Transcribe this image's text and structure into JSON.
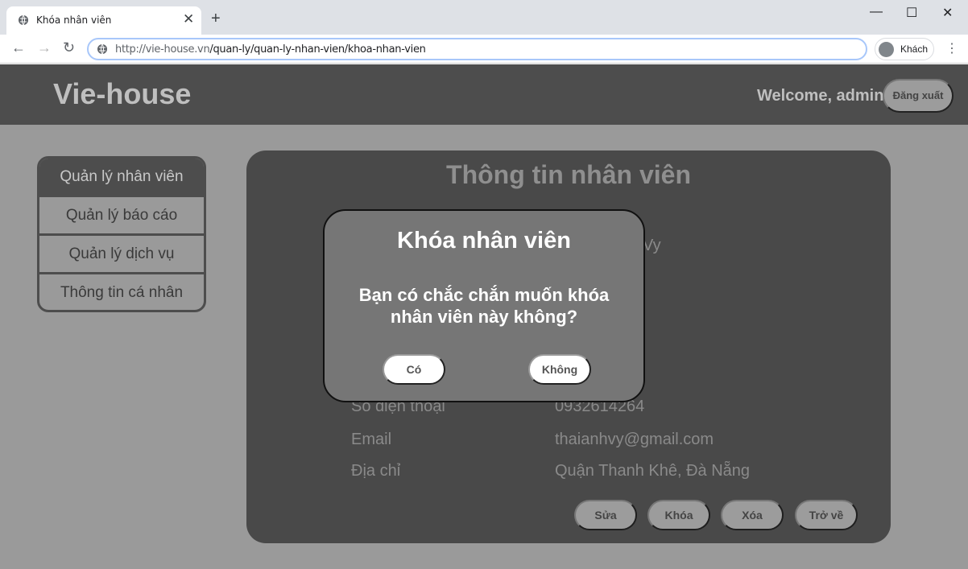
{
  "browser": {
    "tab_title": "Khóa nhân viên",
    "tab_close": "✕",
    "new_tab": "+",
    "url_host": "http://vie-house.vn",
    "url_path": "/quan-ly/quan-ly-nhan-vien/khoa-nhan-vien",
    "profile_label": "Khách",
    "minimize": "—",
    "maximize": "☐",
    "close": "✕",
    "back": "←",
    "forward": "→",
    "reload": "↻",
    "menu": "⋮"
  },
  "header": {
    "logo": "Vie-house",
    "welcome": "Welcome, admin",
    "logout_label": "Đăng xuất"
  },
  "sidebar": {
    "items": [
      {
        "label": "Quản lý nhân viên",
        "active": true
      },
      {
        "label": "Quản lý báo cáo"
      },
      {
        "label": "Quản lý dịch vụ"
      },
      {
        "label": "Thông tin cá nhân"
      }
    ]
  },
  "card": {
    "title": "Thông tin nhân viên",
    "rows": [
      {
        "label": "Số điện thoại",
        "value": "0932614264"
      },
      {
        "label": "Email",
        "value": "thaianhvy@gmail.com"
      },
      {
        "label": "Địa chỉ",
        "value": "Quận Thanh Khê, Đà Nẵng"
      }
    ],
    "partial_values": {
      "top": "…",
      "name_tail": "Vy"
    },
    "actions": {
      "edit": "Sửa",
      "lock": "Khóa",
      "delete": "Xóa",
      "back": "Trở về"
    }
  },
  "modal": {
    "title": "Khóa nhân viên",
    "message": "Bạn có chắc chắn muốn khóa nhân viên này không?",
    "yes": "Có",
    "no": "Không"
  },
  "colors": {
    "header_bg": "#4d4d4d",
    "page_bg": "#9a9a9a",
    "card_bg": "#494949",
    "modal_bg": "#767676"
  }
}
